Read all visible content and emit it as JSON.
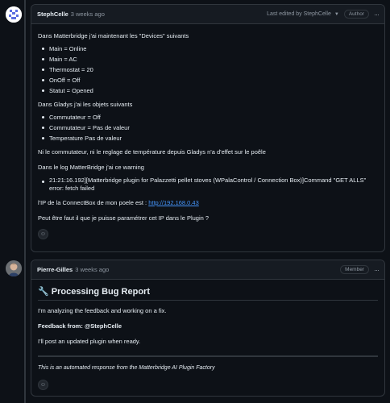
{
  "comments": [
    {
      "author": "StephCelle",
      "time": "3 weeks ago",
      "edited_prefix": "Last edited by",
      "edited_by": "StephCelle",
      "role": "Author",
      "p1": "Dans Matterbridge j'ai maintenant les \"Devices\" suivants",
      "devices": [
        "Main = Online",
        "Main = AC",
        "Thermostat = 20",
        "OnOff = Off",
        "Statut = Opened"
      ],
      "p2": "Dans Gladys j'ai les objets suivants",
      "gladys": [
        "Commutateur = Off",
        "Commutateur = Pas de valeur",
        "Temperature Pas de valeur"
      ],
      "p3": "Ni le commutateur, ni le reglage de température depuis Gladys n'a d'effet sur le poêle",
      "p4": "Dans le log MatterBridge j'ai ce warning",
      "warning_line1": "21:21:16.192][Matterbridge plugin for Palazzetti pellet stoves (WPalaControl / Connection Box)]Command \"GET ALLS\"",
      "warning_line2": "error: fetch failed",
      "ip_prefix": "l'IP de la ConnectBox de mon poele est : ",
      "ip_link": "http://192.168.0.43",
      "p5": "Peut être faut il que je puisse paramétrer cet IP dans le Plugin ?"
    },
    {
      "author": "Pierre-Gilles",
      "time": "3 weeks ago",
      "role": "Member",
      "heading": "🔧 Processing Bug Report",
      "p1": "I'm analyzing the feedback and working on a fix.",
      "feedback_label": "Feedback from: ",
      "feedback_mention": "@StephCelle",
      "p2": "I'll post an updated plugin when ready.",
      "footer": "This is an automated response from the Matterbridge AI Plugin Factory"
    }
  ],
  "icons": {
    "reaction": "smiley-icon",
    "menu": "kebab-icon",
    "caret": "triangle-down-icon"
  }
}
